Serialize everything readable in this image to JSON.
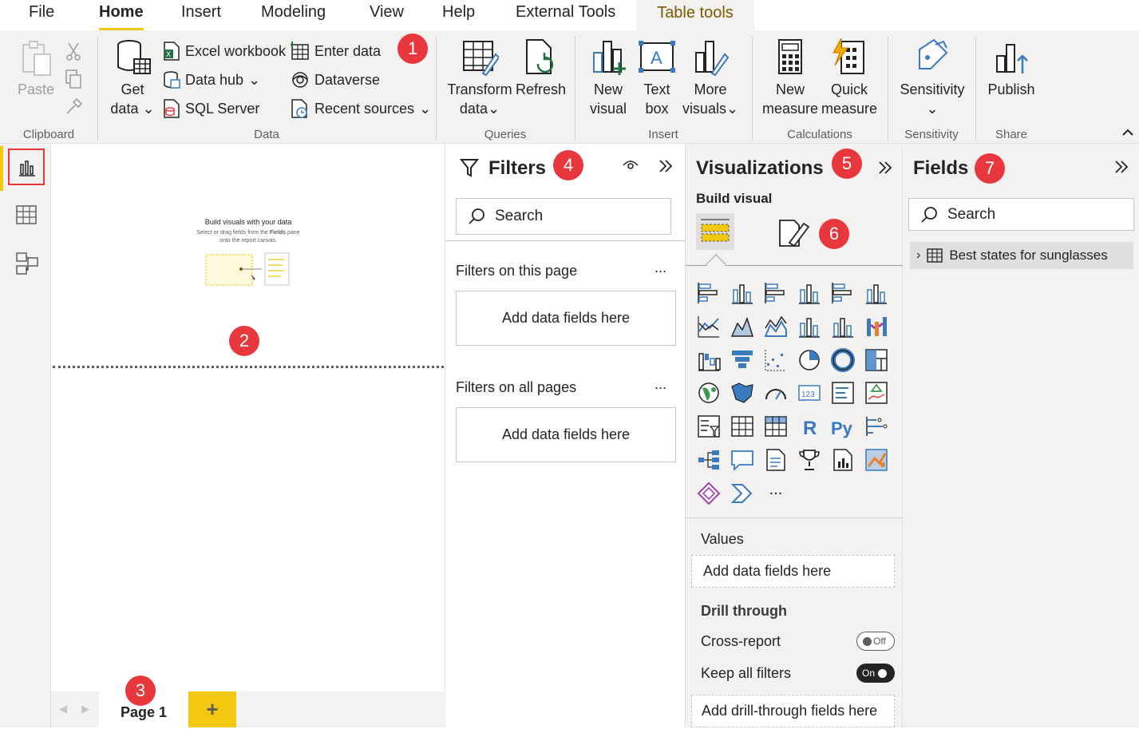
{
  "menu": {
    "tabs": [
      "File",
      "Home",
      "Insert",
      "Modeling",
      "View",
      "Help",
      "External Tools"
    ],
    "context_tab": "Table tools"
  },
  "ribbon": {
    "clipboard": {
      "paste": "Paste",
      "group": "Clipboard"
    },
    "data": {
      "get_data_1": "Get",
      "get_data_2": "data",
      "excel": "Excel workbook",
      "datahub": "Data hub",
      "sql": "SQL Server",
      "enter": "Enter data",
      "dataverse": "Dataverse",
      "recent": "Recent sources",
      "group": "Data"
    },
    "queries": {
      "transform_1": "Transform",
      "transform_2": "data",
      "refresh": "Refresh",
      "group": "Queries"
    },
    "insert": {
      "newvisual_1": "New",
      "newvisual_2": "visual",
      "textbox_1": "Text",
      "textbox_2": "box",
      "more_1": "More",
      "more_2": "visuals",
      "group": "Insert"
    },
    "calc": {
      "newm_1": "New",
      "newm_2": "measure",
      "quick_1": "Quick",
      "quick_2": "measure",
      "group": "Calculations"
    },
    "sensitivity": {
      "label": "Sensitivity",
      "group": "Sensitivity"
    },
    "share": {
      "publish": "Publish",
      "group": "Share"
    }
  },
  "canvas": {
    "empty_title": "Build visuals with your data",
    "empty_line1_a": "Select or drag fields from the ",
    "empty_line1_b": "Fields",
    "empty_line1_c": " pane",
    "empty_line2": "onto the report canvas."
  },
  "pages": {
    "tabs": [
      "Page 1"
    ],
    "add": "+"
  },
  "filters": {
    "title": "Filters",
    "search_placeholder": "Search",
    "this_page": "Filters on this page",
    "all_pages": "Filters on all pages",
    "more": "...",
    "add_fields": "Add data fields here"
  },
  "visualizations": {
    "title": "Visualizations",
    "build_visual": "Build visual",
    "more": "...",
    "values_label": "Values",
    "values_well": "Add data fields here",
    "drill_label": "Drill through",
    "cross_report": "Cross-report",
    "cross_report_state": "Off",
    "keep_filters": "Keep all filters",
    "keep_filters_state": "On",
    "drill_well": "Add drill-through fields here",
    "icon_names": [
      "stacked-bar",
      "stacked-column",
      "clustered-bar",
      "clustered-column",
      "100-stacked-bar",
      "100-stacked-column",
      "line",
      "area",
      "stacked-area",
      "line-clustered-column",
      "line-stacked-column",
      "ribbon",
      "waterfall",
      "funnel",
      "scatter",
      "pie",
      "donut",
      "treemap",
      "map",
      "filled-map",
      "gauge",
      "card",
      "multi-row-card",
      "kpi",
      "slicer",
      "table",
      "matrix",
      "r-visual",
      "python-visual",
      "key-influencers",
      "decomposition-tree",
      "qa",
      "smart-narrative",
      "metrics",
      "paginated-report",
      "azure-map",
      "power-apps",
      "power-automate"
    ]
  },
  "fields": {
    "title": "Fields",
    "search_placeholder": "Search",
    "tables": [
      "Best states for sunglasses"
    ]
  },
  "badges": [
    "1",
    "2",
    "3",
    "4",
    "5",
    "6",
    "7"
  ],
  "colors": {
    "accent": "#f2c811",
    "badge": "#e8383d",
    "icon_blue": "#3a7bbf"
  }
}
